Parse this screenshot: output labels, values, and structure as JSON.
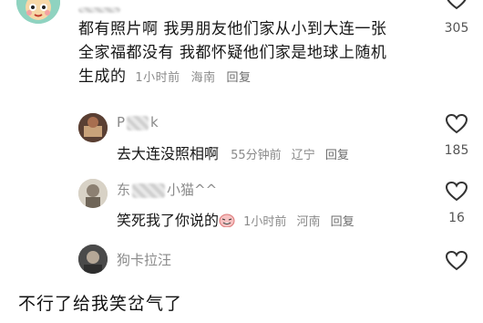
{
  "comment": {
    "text_line1": "都有照片啊 我男朋友他们家从小到大连一张",
    "text_line2": "全家福都没有 我都怀疑他们家是地球上随机",
    "text_line3": "生成的",
    "time": "1小时前",
    "location": "海南",
    "reply_label": "回复",
    "like_count": "305"
  },
  "replies": [
    {
      "name_visible": "P",
      "name_tail": "k",
      "text": "去大连没照相啊",
      "time": "55分钟前",
      "location": "辽宁",
      "reply_label": "回复",
      "like_count": "185"
    },
    {
      "name_visible": "东",
      "name_tail": "小猫^^",
      "text": "笑死我了你说的",
      "time": "1小时前",
      "location": "河南",
      "reply_label": "回复",
      "like_count": "16"
    },
    {
      "name": "狗卡拉汪"
    }
  ],
  "bottom_caption": "不行了给我笑岔气了",
  "icons": {
    "like": "heart-outline-icon",
    "sticker": "laughing-sticker-icon"
  },
  "colors": {
    "meta_gray": "#8a8a8a",
    "text": "#161616"
  }
}
